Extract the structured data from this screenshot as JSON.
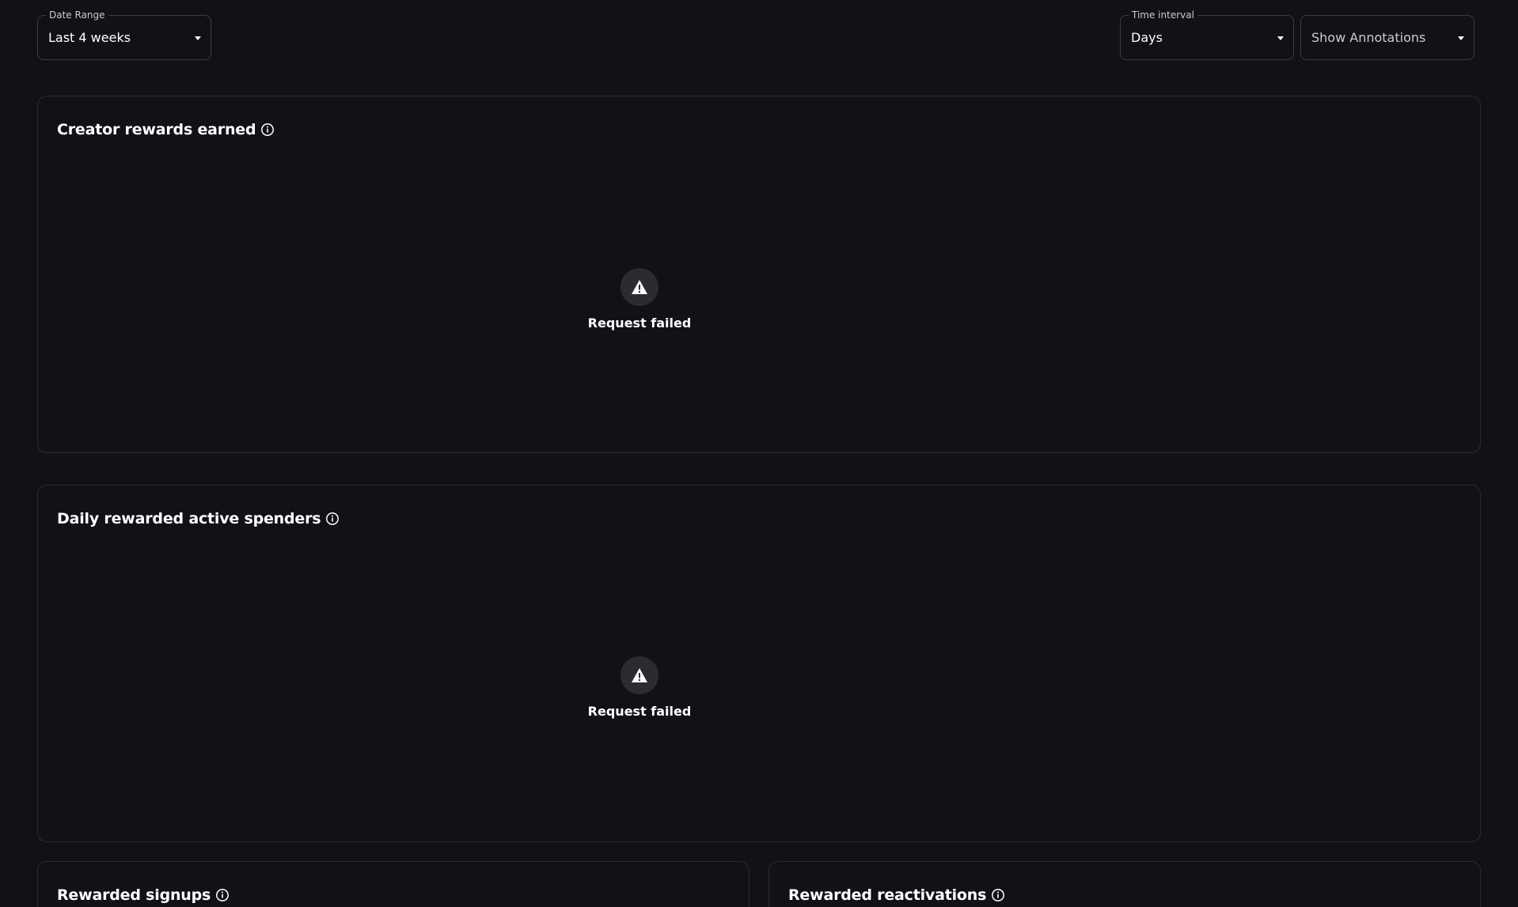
{
  "filters": {
    "date_range": {
      "label": "Date Range",
      "value": "Last 4 weeks"
    },
    "time_interval": {
      "label": "Time interval",
      "value": "Days"
    },
    "annotations": {
      "placeholder": "Show Annotations"
    }
  },
  "cards": [
    {
      "title": "Creator rewards earned",
      "status": "Request failed"
    },
    {
      "title": "Daily rewarded active spenders",
      "status": "Request failed"
    },
    {
      "title": "Rewarded signups"
    },
    {
      "title": "Rewarded reactivations"
    }
  ],
  "icons": {
    "info": "info-icon",
    "warning": "warning-triangle-icon",
    "dropdown": "chevron-down-icon"
  },
  "colors": {
    "background": "#111216",
    "card_border": "#2a2c32",
    "select_border": "#3a3c42",
    "error_badge": "#2a2c31",
    "text": "#ffffff"
  }
}
